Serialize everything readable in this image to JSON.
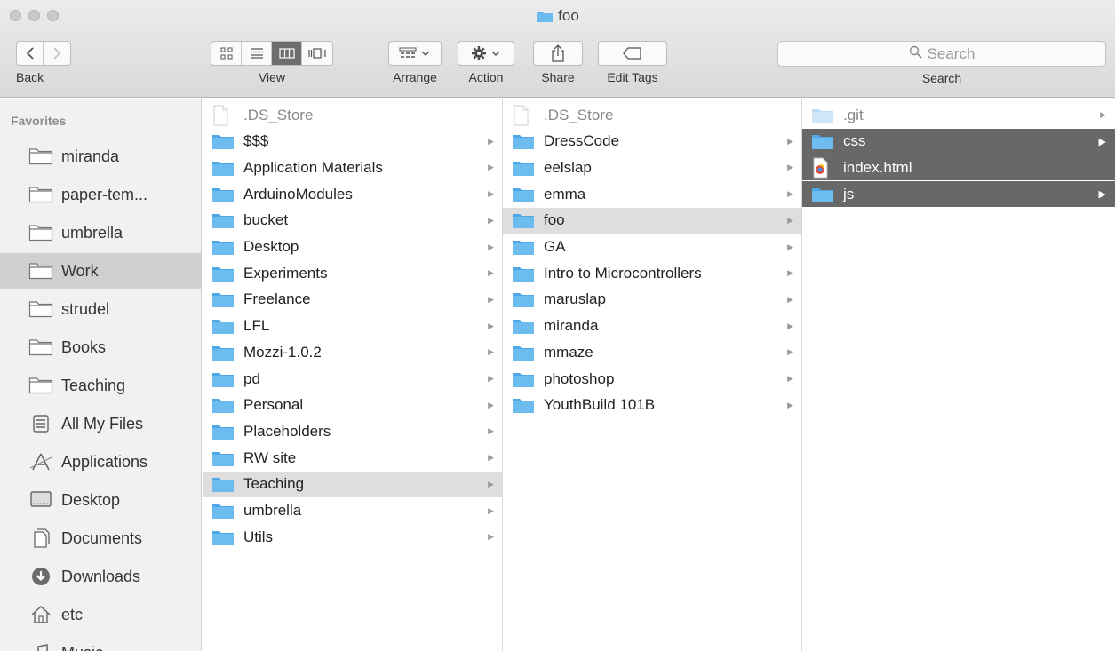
{
  "window": {
    "title": "foo"
  },
  "toolbar": {
    "back_label": "Back",
    "view_label": "View",
    "arrange_label": "Arrange",
    "action_label": "Action",
    "share_label": "Share",
    "edit_tags_label": "Edit Tags",
    "search_label": "Search",
    "search_placeholder": "Search"
  },
  "sidebar": {
    "header": "Favorites",
    "items": [
      {
        "label": "miranda",
        "icon": "folder-icon"
      },
      {
        "label": "paper-tem...",
        "icon": "folder-icon"
      },
      {
        "label": "umbrella",
        "icon": "folder-icon"
      },
      {
        "label": "Work",
        "icon": "folder-icon",
        "selected": true
      },
      {
        "label": "strudel",
        "icon": "folder-icon"
      },
      {
        "label": "Books",
        "icon": "folder-icon"
      },
      {
        "label": "Teaching",
        "icon": "folder-icon"
      },
      {
        "label": "All My Files",
        "icon": "all-files-icon"
      },
      {
        "label": "Applications",
        "icon": "applications-icon"
      },
      {
        "label": "Desktop",
        "icon": "desktop-icon"
      },
      {
        "label": "Documents",
        "icon": "documents-icon"
      },
      {
        "label": "Downloads",
        "icon": "downloads-icon"
      },
      {
        "label": "etc",
        "icon": "home-icon"
      },
      {
        "label": "Music",
        "icon": "music-icon"
      }
    ]
  },
  "columns": [
    {
      "items": [
        {
          "label": ".DS_Store",
          "type": "file",
          "ghost": true
        },
        {
          "label": "$$$",
          "type": "folder"
        },
        {
          "label": "Application Materials",
          "type": "folder"
        },
        {
          "label": "ArduinoModules",
          "type": "folder"
        },
        {
          "label": "bucket",
          "type": "folder"
        },
        {
          "label": "Desktop",
          "type": "folder"
        },
        {
          "label": "Experiments",
          "type": "folder"
        },
        {
          "label": "Freelance",
          "type": "folder"
        },
        {
          "label": "LFL",
          "type": "folder"
        },
        {
          "label": "Mozzi-1.0.2",
          "type": "folder"
        },
        {
          "label": "pd",
          "type": "folder"
        },
        {
          "label": "Personal",
          "type": "folder"
        },
        {
          "label": "Placeholders",
          "type": "folder"
        },
        {
          "label": "RW site",
          "type": "folder"
        },
        {
          "label": "Teaching",
          "type": "folder",
          "state": "highlight"
        },
        {
          "label": "umbrella",
          "type": "folder"
        },
        {
          "label": "Utils",
          "type": "folder"
        }
      ]
    },
    {
      "items": [
        {
          "label": ".DS_Store",
          "type": "file",
          "ghost": true
        },
        {
          "label": "DressCode",
          "type": "folder"
        },
        {
          "label": "eelslap",
          "type": "folder"
        },
        {
          "label": "emma",
          "type": "folder"
        },
        {
          "label": "foo",
          "type": "folder",
          "state": "highlight"
        },
        {
          "label": "GA",
          "type": "folder"
        },
        {
          "label": "Intro to Microcontrollers",
          "type": "folder"
        },
        {
          "label": "maruslap",
          "type": "folder"
        },
        {
          "label": "miranda",
          "type": "folder"
        },
        {
          "label": "mmaze",
          "type": "folder"
        },
        {
          "label": "photoshop",
          "type": "folder"
        },
        {
          "label": "YouthBuild 101B",
          "type": "folder"
        }
      ]
    },
    {
      "items": [
        {
          "label": ".git",
          "type": "folder",
          "ghost": true
        },
        {
          "label": "css",
          "type": "folder",
          "state": "selected"
        },
        {
          "label": "index.html",
          "type": "html",
          "state": "selected"
        },
        {
          "label": "js",
          "type": "folder",
          "state": "selected"
        }
      ]
    }
  ],
  "colors": {
    "folder": "#5ab0ea",
    "selection": "#686868",
    "highlight": "#dedede",
    "sidebar_bg": "#f1f1f1"
  }
}
